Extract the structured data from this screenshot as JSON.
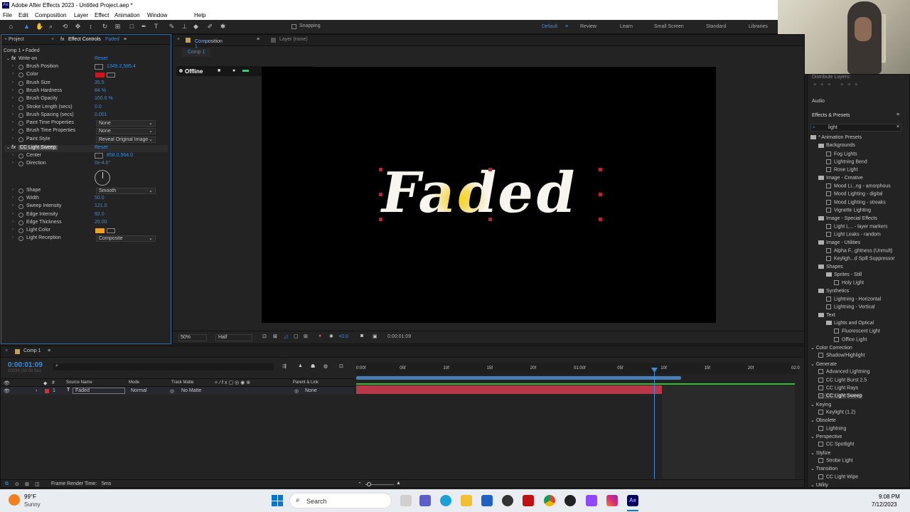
{
  "app": {
    "title": "Adobe After Effects 2023 - Untitled Project.aep *"
  },
  "menu": [
    "File",
    "Edit",
    "Composition",
    "Layer",
    "Effect",
    "Animation",
    "Window",
    "Help"
  ],
  "toolbar": {
    "snapping": "Snapping",
    "workspaces": [
      "Default",
      "Review",
      "Learn",
      "Small Screen",
      "Standard",
      "Libraries"
    ]
  },
  "left_panel": {
    "tab_project": "Project",
    "tab_effect": "Effect Controls",
    "tab_layer": "Faded",
    "breadcrumb": "Comp 1 • Faded",
    "writeon": {
      "name": "Write-on",
      "reset": "Reset"
    },
    "props1": [
      {
        "label": "Brush Position",
        "value": "1349.2,585.4"
      },
      {
        "label": "Color",
        "value": ""
      },
      {
        "label": "Brush Size",
        "value": "35.5"
      },
      {
        "label": "Brush Hardness",
        "value": "84 %"
      },
      {
        "label": "Brush Opacity",
        "value": "100.0 %"
      },
      {
        "label": "Stroke Length (secs)",
        "value": "0.0"
      },
      {
        "label": "Brush Spacing (secs)",
        "value": "0.001"
      },
      {
        "label": "Paint Time Properties",
        "value": "None"
      },
      {
        "label": "Brush Time Properties",
        "value": "None"
      },
      {
        "label": "Paint Style",
        "value": "Reveal Original Image"
      }
    ],
    "lightsweep": {
      "name": "CC Light Sweep",
      "reset": "Reset"
    },
    "props2": [
      {
        "label": "Center",
        "value": "858.0,564.0"
      },
      {
        "label": "Direction",
        "value": "0x-4.0°"
      },
      {
        "label": "Shape",
        "value": "Smooth"
      },
      {
        "label": "Width",
        "value": "50.0"
      },
      {
        "label": "Sweep Intensity",
        "value": "121.0"
      },
      {
        "label": "Edge Intensity",
        "value": "92.0"
      },
      {
        "label": "Edge Thickness",
        "value": "20.00"
      },
      {
        "label": "Light Color",
        "value": ""
      },
      {
        "label": "Light Reception",
        "value": "Composite"
      }
    ]
  },
  "comp_panel": {
    "tab": "Composition",
    "tab_name": "Comp 1",
    "layer_tab": "Layer (none)",
    "comp_chip": "Comp 1",
    "offline": "Offline",
    "count": "0",
    "text": "Faded",
    "zoom": "50%",
    "res": "Half",
    "exposure": "+0.0",
    "time": "0:00:01:09"
  },
  "effects_presets": {
    "distribute": "Distribute Layers:",
    "audio": "Audio",
    "title": "Effects & Presets",
    "search": "light",
    "tree": [
      {
        "t": "* Animation Presets",
        "l": 0,
        "k": "f"
      },
      {
        "t": "Backgrounds",
        "l": 1,
        "k": "f"
      },
      {
        "t": "Fog Lights",
        "l": 2,
        "k": "p"
      },
      {
        "t": "Lightning Bend",
        "l": 2,
        "k": "p"
      },
      {
        "t": "Rose Light",
        "l": 2,
        "k": "p"
      },
      {
        "t": "Image - Creative",
        "l": 1,
        "k": "f"
      },
      {
        "t": "Mood Li...ng - amorphous",
        "l": 2,
        "k": "p"
      },
      {
        "t": "Mood Lighting - digital",
        "l": 2,
        "k": "p"
      },
      {
        "t": "Mood Lighting - streaks",
        "l": 2,
        "k": "p"
      },
      {
        "t": "Vignette Lighting",
        "l": 2,
        "k": "p"
      },
      {
        "t": "Image - Special Effects",
        "l": 1,
        "k": "f"
      },
      {
        "t": "Light L... - layer markers",
        "l": 2,
        "k": "p"
      },
      {
        "t": "Light Leaks - random",
        "l": 2,
        "k": "p"
      },
      {
        "t": "Image - Utilities",
        "l": 1,
        "k": "f"
      },
      {
        "t": "Alpha F...ghtness (Unmult)",
        "l": 2,
        "k": "p"
      },
      {
        "t": "Keyligh...d Spill Suppressor",
        "l": 2,
        "k": "p"
      },
      {
        "t": "Shapes",
        "l": 1,
        "k": "f"
      },
      {
        "t": "Sprites - Still",
        "l": 2,
        "k": "f"
      },
      {
        "t": "Holy Light",
        "l": 3,
        "k": "p"
      },
      {
        "t": "Synthetics",
        "l": 1,
        "k": "f"
      },
      {
        "t": "Lightning - Horizontal",
        "l": 2,
        "k": "p"
      },
      {
        "t": "Lightning - Vertical",
        "l": 2,
        "k": "p"
      },
      {
        "t": "Text",
        "l": 1,
        "k": "f"
      },
      {
        "t": "Lights and Optical",
        "l": 2,
        "k": "f"
      },
      {
        "t": "Fluorescent Light",
        "l": 3,
        "k": "p"
      },
      {
        "t": "Office Light",
        "l": 3,
        "k": "p"
      },
      {
        "t": "Color Correction",
        "l": 0,
        "k": "c"
      },
      {
        "t": "Shadow/Highlight",
        "l": 1,
        "k": "p"
      },
      {
        "t": "Generate",
        "l": 0,
        "k": "c"
      },
      {
        "t": "Advanced Lightning",
        "l": 1,
        "k": "p"
      },
      {
        "t": "CC Light Burst 2.5",
        "l": 1,
        "k": "p"
      },
      {
        "t": "CC Light Rays",
        "l": 1,
        "k": "p"
      },
      {
        "t": "CC Light Sweep",
        "l": 1,
        "k": "p",
        "sel": true
      },
      {
        "t": "Keying",
        "l": 0,
        "k": "c"
      },
      {
        "t": "Keylight (1.2)",
        "l": 1,
        "k": "p"
      },
      {
        "t": "Obsolete",
        "l": 0,
        "k": "c"
      },
      {
        "t": "Lightning",
        "l": 1,
        "k": "p"
      },
      {
        "t": "Perspective",
        "l": 0,
        "k": "c"
      },
      {
        "t": "CC Spotlight",
        "l": 1,
        "k": "p"
      },
      {
        "t": "Stylize",
        "l": 0,
        "k": "c"
      },
      {
        "t": "Strobe Light",
        "l": 1,
        "k": "p"
      },
      {
        "t": "Transition",
        "l": 0,
        "k": "c"
      },
      {
        "t": "CC Light Wipe",
        "l": 1,
        "k": "p"
      },
      {
        "t": "Utility",
        "l": 0,
        "k": "c"
      }
    ]
  },
  "timeline": {
    "tab": "Comp 1",
    "timecode": "0:00:01:09",
    "frames": "00039 (30.00 fps)",
    "col_source": "Source Name",
    "col_mode": "Mode",
    "col_trackmatte": "Track Matte",
    "col_parent": "Parent & Link",
    "layer_num": "1",
    "layer_name": "Faded",
    "layer_mode": "Normal",
    "layer_matte": "No Matte",
    "layer_parent": "None",
    "ruler": [
      "0:00f",
      "05f",
      "10f",
      "15f",
      "20f",
      "01:00f",
      "05f",
      "10f",
      "15f",
      "20f",
      "02:0"
    ],
    "render": "Frame Render Time:",
    "render_val": "5ms"
  },
  "taskbar": {
    "temp": "99°F",
    "weather": "Sunny",
    "search": "Search",
    "time": "9:08 PM",
    "date": "7/12/2023"
  }
}
